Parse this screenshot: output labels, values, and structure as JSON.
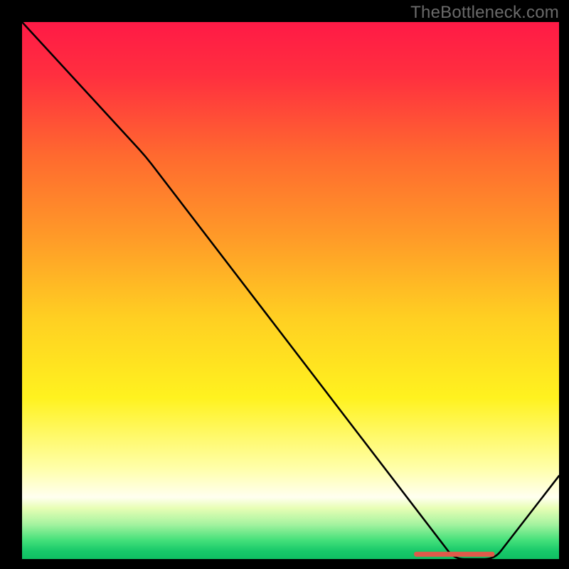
{
  "watermark": "TheBottleneck.com",
  "chart_data": {
    "type": "line",
    "title": "",
    "xlabel": "",
    "ylabel": "",
    "xlim": [
      0,
      100
    ],
    "ylim": [
      0,
      100
    ],
    "grid": false,
    "x": [
      0,
      23,
      80.5,
      88,
      100
    ],
    "values": [
      100,
      75,
      0,
      0,
      15.5
    ],
    "series": [
      {
        "name": "curve",
        "x": [
          0,
          23,
          80.5,
          88,
          100
        ],
        "values": [
          100,
          75,
          0,
          0,
          15.5
        ]
      }
    ],
    "optimal_band": {
      "x_start": 73,
      "x_end": 88,
      "y": 0.9
    },
    "background_gradient": {
      "stops": [
        {
          "offset": 0.0,
          "color": "#ff1a46"
        },
        {
          "offset": 0.1,
          "color": "#ff2f3f"
        },
        {
          "offset": 0.25,
          "color": "#ff6a2f"
        },
        {
          "offset": 0.4,
          "color": "#ff9a28"
        },
        {
          "offset": 0.55,
          "color": "#ffcf22"
        },
        {
          "offset": 0.7,
          "color": "#fff21f"
        },
        {
          "offset": 0.83,
          "color": "#ffffa8"
        },
        {
          "offset": 0.885,
          "color": "#fffff0"
        },
        {
          "offset": 0.905,
          "color": "#e8feb5"
        },
        {
          "offset": 0.935,
          "color": "#a6f3a0"
        },
        {
          "offset": 0.965,
          "color": "#44e07a"
        },
        {
          "offset": 0.985,
          "color": "#18c96a"
        },
        {
          "offset": 1.0,
          "color": "#0fbf63"
        }
      ]
    }
  }
}
